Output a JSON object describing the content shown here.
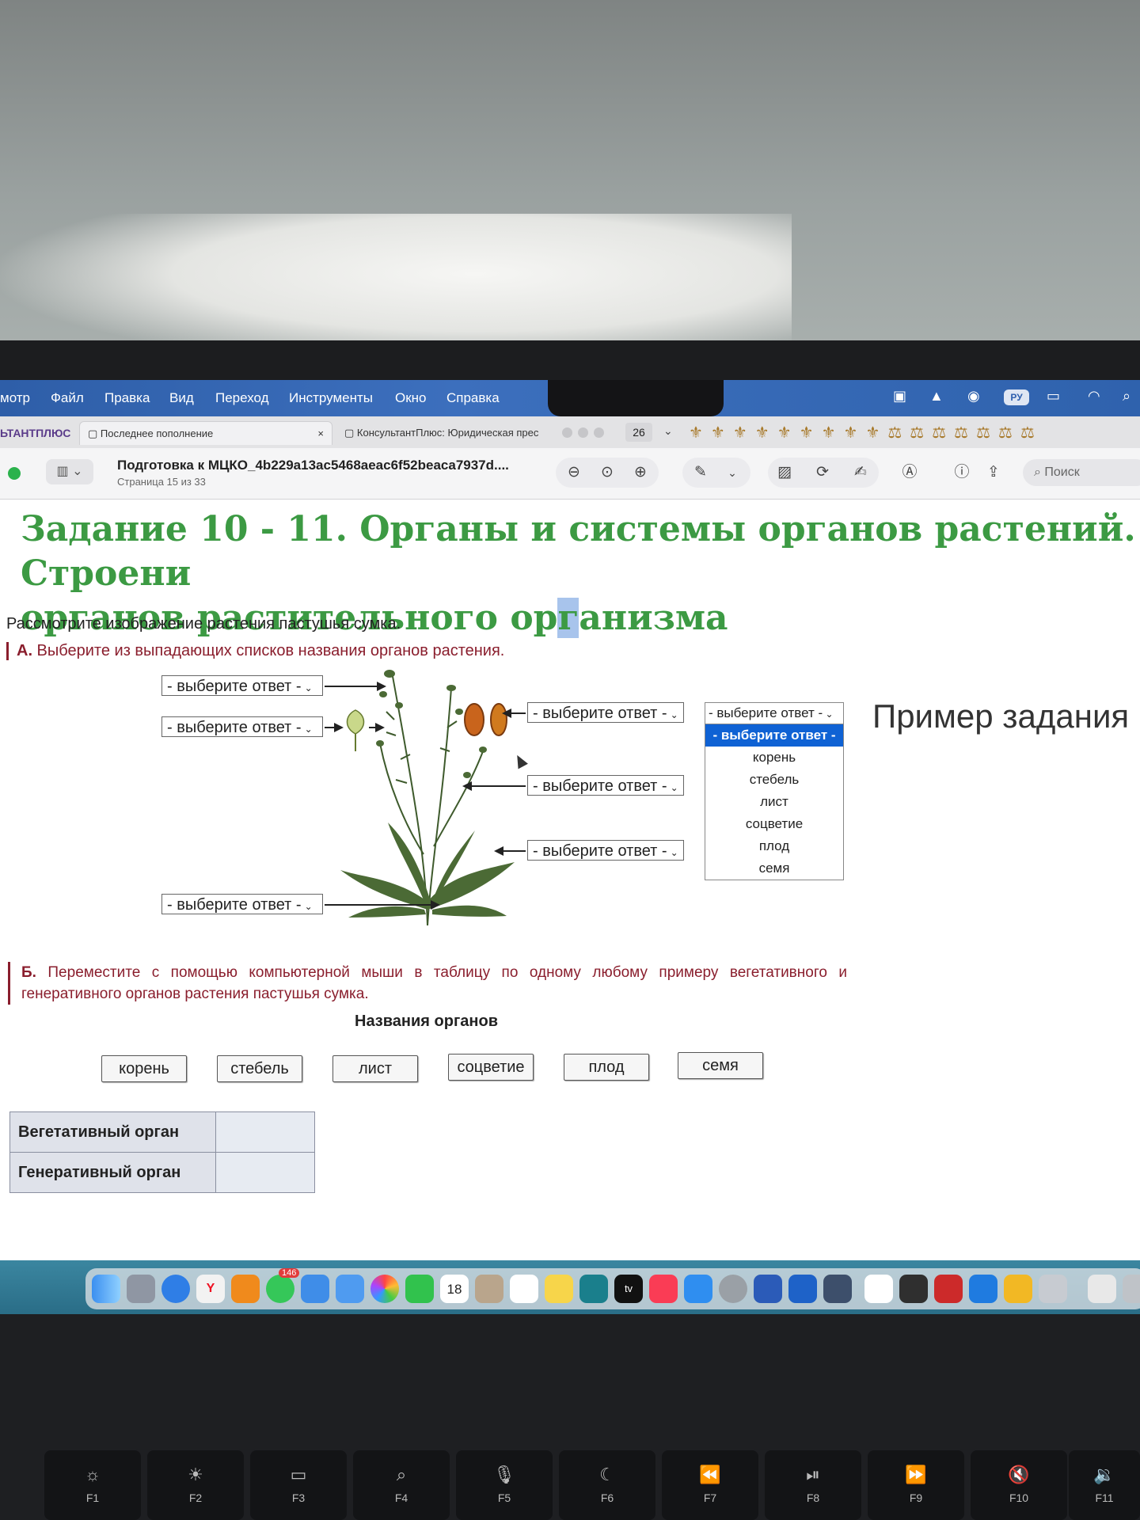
{
  "menubar": {
    "items": [
      "мотр",
      "Файл",
      "Правка",
      "Вид",
      "Переход",
      "Инструменты",
      "Окно",
      "Справка"
    ],
    "lang": "РУ"
  },
  "tabs": {
    "brand": "ЬТАНТПЛЮС",
    "tab1": "Последнее пополнение",
    "tab1_close": "×",
    "tab2": "КонсультантПлюс: Юридическая прес",
    "page_count": "26"
  },
  "toolbar": {
    "doc_title": "Подготовка к МЦКО_4b229a13ac5468aeac6f52beaca7937d....",
    "doc_sub": "Страница 15 из 33",
    "search_placeholder": "Поиск"
  },
  "page": {
    "title_line1": "Задание 10 - 11. Органы и системы органов растений. Строени",
    "title_line2_a": "органов растительного ор",
    "title_line2_sel": "г",
    "title_line2_b": "анизма",
    "intro": "Рассмотрите изображение растения пастушья сумка.",
    "task_a_label": "А.",
    "task_a_text": " Выберите из выпадающих списков названия органов растения.",
    "select_placeholder": "- выберите ответ -",
    "dropdown": {
      "head": "- выберите ответ -",
      "options": [
        "- выберите ответ -",
        "корень",
        "стебель",
        "лист",
        "соцветие",
        "плод",
        "семя"
      ]
    },
    "example_label": "Пример задания",
    "task_b_label": "Б.",
    "task_b_text": " Переместите с помощью компьютерной мыши в таблицу по одному любому примеру вегетативного и генеративного органов растения пастушья сумка.",
    "organs_title": "Названия органов",
    "chips": [
      "корень",
      "стебель",
      "лист",
      "соцветие",
      "плод",
      "семя"
    ],
    "table": {
      "row1": "Вегетативный орган",
      "row2": "Генеративный орган"
    }
  },
  "dock": {
    "calendar_day": "18",
    "messages_badge": "146",
    "tv_label": "tv"
  },
  "keyboard": {
    "keys": [
      "F1",
      "F2",
      "F3",
      "F4",
      "F5",
      "F6",
      "F7",
      "F8",
      "F9",
      "F10",
      "F11"
    ]
  }
}
